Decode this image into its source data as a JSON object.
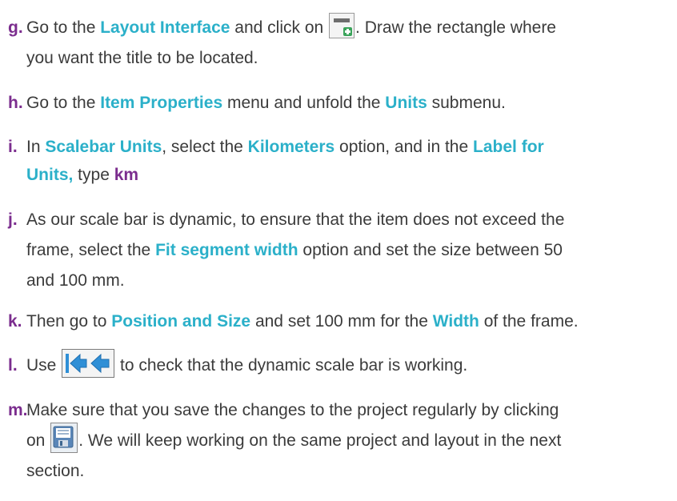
{
  "steps": {
    "g": {
      "letter": "g.",
      "t1": "Go to the ",
      "h1": "Layout Interface",
      "t2": " and click on ",
      "t3": ". Draw the rectangle where",
      "line2": "you want the title to be located."
    },
    "h": {
      "letter": "h.",
      "t1": "Go to the ",
      "h1": "Item Properties",
      "t2": " menu and unfold the ",
      "h2": "Units",
      "t3": " submenu."
    },
    "i": {
      "letter": "i.",
      "t1": "In ",
      "h1": "Scalebar Units",
      "t2": ", select the ",
      "h2": "Kilometers",
      "t3": " option, and in the ",
      "h3": "Label for",
      "h4": "Units,",
      "t4": " type ",
      "h5": "km"
    },
    "j": {
      "letter": "j.",
      "line1": "As our scale bar is dynamic, to ensure that the item does not exceed the",
      "t1": "frame, select the ",
      "h1": "Fit segment width",
      "t2": " option and set the size between 50",
      "line3": "and 100 mm."
    },
    "k": {
      "letter": "k.",
      "t1": "Then go to ",
      "h1": "Position and Size",
      "t2": " and set 100 mm for the ",
      "h2": "Width",
      "t3": " of the frame."
    },
    "l": {
      "letter": "l.",
      "t1": "Use ",
      "t2": " to check that the dynamic scale bar is working."
    },
    "m": {
      "letter": "m.",
      "line1": "Make sure that you save the changes to the project regularly by clicking",
      "t1": "on ",
      "t2": ". We will keep working on the same project and layout in the next",
      "line3": "section."
    }
  },
  "icons": {
    "add_label": "add-label-icon",
    "refresh_arrows": "back-arrows-icon",
    "save": "save-project-icon"
  },
  "colors": {
    "highlight": "#2bb0c9",
    "letter": "#7b2d8e",
    "text": "#3b3b3b"
  }
}
